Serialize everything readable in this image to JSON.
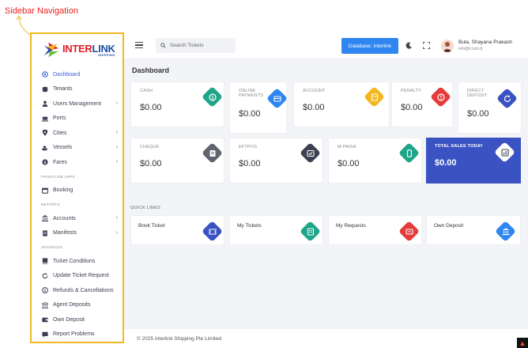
{
  "annotation": {
    "label": "Sidebar Navigation"
  },
  "brand": {
    "name_red": "INTER",
    "name_blue": "LINK",
    "sub": "SHIPPING"
  },
  "sidebar": {
    "items": [
      {
        "label": "Dashboard",
        "icon": "dashboard-icon",
        "active": true
      },
      {
        "label": "Tenants",
        "icon": "database-icon"
      },
      {
        "label": "Users Management",
        "icon": "user-icon",
        "chevron": true
      },
      {
        "label": "Ports",
        "icon": "port-icon"
      },
      {
        "label": "Cities",
        "icon": "location-icon",
        "chevron": true
      },
      {
        "label": "Vessels",
        "icon": "ship-icon",
        "chevron": true
      },
      {
        "label": "Fares",
        "icon": "dollar-icon",
        "chevron": true
      }
    ],
    "section_frontline": "FRONTLINE APPS",
    "frontline_items": [
      {
        "label": "Booking",
        "icon": "calendar-icon"
      }
    ],
    "section_reports": "REPORTS",
    "report_items": [
      {
        "label": "Accounts",
        "icon": "bank-icon",
        "chevron": true
      },
      {
        "label": "Manifests",
        "icon": "document-icon",
        "chevron": true
      }
    ],
    "section_advanced": "ADVANCED",
    "advanced_items": [
      {
        "label": "Ticket Conditions",
        "icon": "book-icon"
      },
      {
        "label": "Update Ticket Request",
        "icon": "refresh-icon"
      },
      {
        "label": "Refunds & Cancellations",
        "icon": "refund-icon"
      },
      {
        "label": "Agent Deposits",
        "icon": "bank-icon"
      },
      {
        "label": "Own Deposit",
        "icon": "wallet-icon"
      },
      {
        "label": "Report Problems",
        "icon": "flag-icon"
      }
    ]
  },
  "topbar": {
    "search_placeholder": "Search Tickets",
    "database_button": "Database: Interlink",
    "user_name": "Bula, Shayana Prakash",
    "user_email": "info@it.com.fj"
  },
  "main": {
    "title": "Dashboard",
    "cards": [
      {
        "label": "CASH",
        "value": "$0.00",
        "color": "#1fa58a",
        "icon": "money-icon"
      },
      {
        "label": "ONLINE PAYMENTS",
        "value": "$0.00",
        "color": "#2f86f0",
        "icon": "card-icon"
      },
      {
        "label": "ACCOUNT",
        "value": "$0.00",
        "color": "#f2b822",
        "icon": "ledger-icon"
      },
      {
        "label": "PENALTY",
        "value": "$0.00",
        "color": "#e53b3b",
        "icon": "alert-icon"
      },
      {
        "label": "DIRECT DEPOSIT",
        "value": "$0.00",
        "color": "#3a52c2",
        "icon": "transfer-icon"
      },
      {
        "label": "CHEQUE",
        "value": "$0.00",
        "color": "#5f6470",
        "icon": "cheque-icon"
      },
      {
        "label": "EFTPOS",
        "value": "$0.00",
        "color": "#3b4152",
        "icon": "terminal-icon"
      },
      {
        "label": "M-PAISA",
        "value": "$0.00",
        "color": "#1fa58a",
        "icon": "mobile-icon"
      },
      {
        "label": "TOTAL SALES TODAY",
        "value": "$0.00",
        "color": "#ffffff",
        "icon": "chart-icon"
      }
    ],
    "quick_links_title": "QUICK LINKS",
    "quick_links": [
      {
        "label": "Book Ticket",
        "color": "#3a52c2",
        "icon": "ticket-icon"
      },
      {
        "label": "My Tickets",
        "color": "#1fa58a",
        "icon": "list-icon"
      },
      {
        "label": "My Requests",
        "color": "#e53b3b",
        "icon": "request-icon"
      },
      {
        "label": "Own Deposit",
        "color": "#2f86f0",
        "icon": "bank-icon"
      }
    ]
  },
  "footer": {
    "text": "© 2025 Interlink Shipping Pte Limited"
  }
}
